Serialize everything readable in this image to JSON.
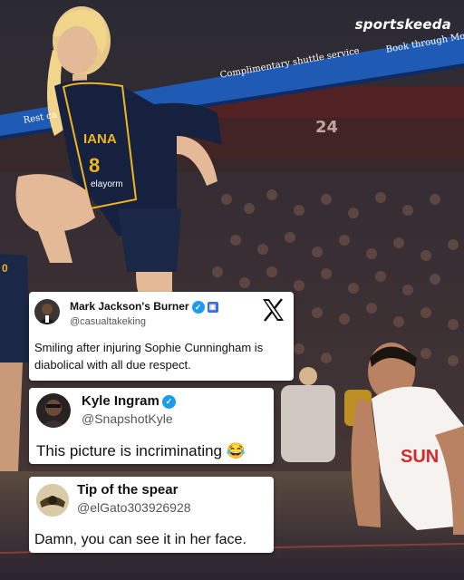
{
  "brand": "sportskeeda",
  "banner": {
    "shuttle_text": "Complimentary shuttle service",
    "book_text": "Book through Mo",
    "rest_text": "Rest ca",
    "section_number": "24"
  },
  "jersey": {
    "team": "IANA",
    "number": "8",
    "sponsor": "elayorm"
  },
  "left_jersey": {
    "number": "0"
  },
  "right_jersey": {
    "team": "SUN"
  },
  "posts": [
    {
      "name": "Mark Jackson's Burner",
      "handle": "@casualtakeking",
      "text_line1": "Smiling after injuring Sophie Cunningham is",
      "text_line2": "diabolical with all due respect."
    },
    {
      "name": "Kyle Ingram",
      "handle": "@SnapshotKyle",
      "text": "This picture is incriminating",
      "emoji": "😂"
    },
    {
      "name": "Tip of the spear",
      "handle": "@elGato303926928",
      "text": "Damn, you can see it in her face."
    }
  ],
  "x_logo": "X",
  "colors": {
    "verified": "#1d9bf0",
    "banner": "#1f5bb5",
    "sun_red": "#d62a2a",
    "fever_navy": "#15213f",
    "fever_gold": "#f1b51c"
  }
}
